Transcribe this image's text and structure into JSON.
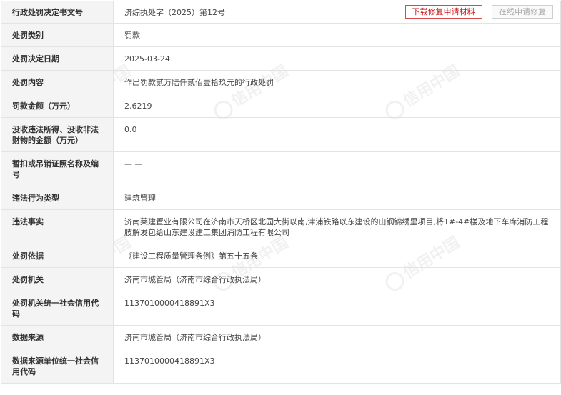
{
  "actions": {
    "download_label": "下载修复申请材料",
    "repair_label": "在线申请修复"
  },
  "watermark": "信用中国",
  "rows": [
    {
      "label": "行政处罚决定书文号",
      "value": "济综执处字（2025）第12号"
    },
    {
      "label": "处罚类别",
      "value": "罚款"
    },
    {
      "label": "处罚决定日期",
      "value": "2025-03-24"
    },
    {
      "label": "处罚内容",
      "value": "作出罚款贰万陆仟贰佰壹拾玖元的行政处罚"
    },
    {
      "label": "罚款金额（万元）",
      "value": "2.6219"
    },
    {
      "label": "没收违法所得、没收非法财物的金额（万元）",
      "value": "0.0"
    },
    {
      "label": "暂扣或吊销证照名称及编号",
      "value": "— —"
    },
    {
      "label": "违法行为类型",
      "value": "建筑管理"
    },
    {
      "label": "违法事实",
      "value": "济南莱建置业有限公司在济南市天桥区北园大街以南,津浦铁路以东建设的山钢锦绣里项目,将1#-4#楼及地下车库消防工程肢解发包给山东建设建工集团消防工程有限公司"
    },
    {
      "label": "处罚依据",
      "value": "《建设工程质量管理条例》第五十五条"
    },
    {
      "label": "处罚机关",
      "value": "济南市城管局（济南市综合行政执法局）"
    },
    {
      "label": "处罚机关统一社会信用代码",
      "value": "1137010000418891X3"
    },
    {
      "label": "数据来源",
      "value": "济南市城管局（济南市综合行政执法局）"
    },
    {
      "label": "数据来源单位统一社会信用代码",
      "value": "1137010000418891X3"
    }
  ]
}
